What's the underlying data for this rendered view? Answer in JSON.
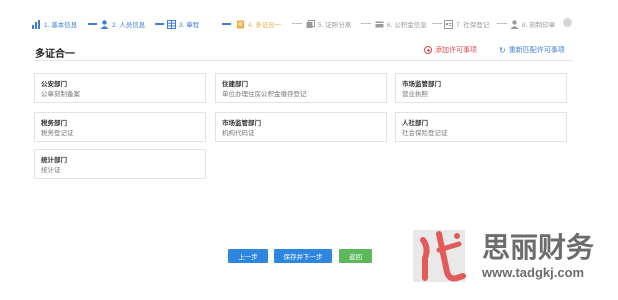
{
  "steps": [
    {
      "label": "1. 基本信息",
      "icon": "bar-chart-icon",
      "state": "done"
    },
    {
      "label": "2. 人员信息",
      "icon": "person-icon",
      "state": "done"
    },
    {
      "label": "3. 章程",
      "icon": "table-icon",
      "state": "done"
    },
    {
      "label": "4. 多证合一",
      "icon": "document-icon",
      "state": "current"
    },
    {
      "label": "5. 证照分离",
      "icon": "cards-icon",
      "state": "pending"
    },
    {
      "label": "6. 公积金信息",
      "icon": "card-icon",
      "state": "pending"
    },
    {
      "label": "7. 社保登记",
      "icon": "id-card-icon",
      "state": "pending"
    },
    {
      "label": "8. 刻制印章",
      "icon": "person-icon",
      "state": "pending"
    }
  ],
  "colors": {
    "accent": "#3d7fd6",
    "current": "#f0a940",
    "pending": "#b9b9b9",
    "danger": "#e04848",
    "success": "#5db85c"
  },
  "page": {
    "title": "多证合一",
    "add_link": "添加许可事项",
    "reset_link": "重新匹配许可事项"
  },
  "cards": [
    {
      "dept": "公安部门",
      "item": "公章刻制备案"
    },
    {
      "dept": "住建部门",
      "item": "单位办理住房公积金缴存登记"
    },
    {
      "dept": "市场监管部门",
      "item": "营业执照"
    },
    {
      "dept": "税务部门",
      "item": "税务登记证"
    },
    {
      "dept": "市场监管部门",
      "item": "机构代码证"
    },
    {
      "dept": "人社部门",
      "item": "社会保险登记证"
    },
    {
      "dept": "统计部门",
      "item": "统计证"
    }
  ],
  "buttons": {
    "prev": "上一步",
    "next": "保存并下一步",
    "back": "返回"
  },
  "watermark": {
    "brand": "思丽财务",
    "url": "www.tadgkj.com"
  }
}
